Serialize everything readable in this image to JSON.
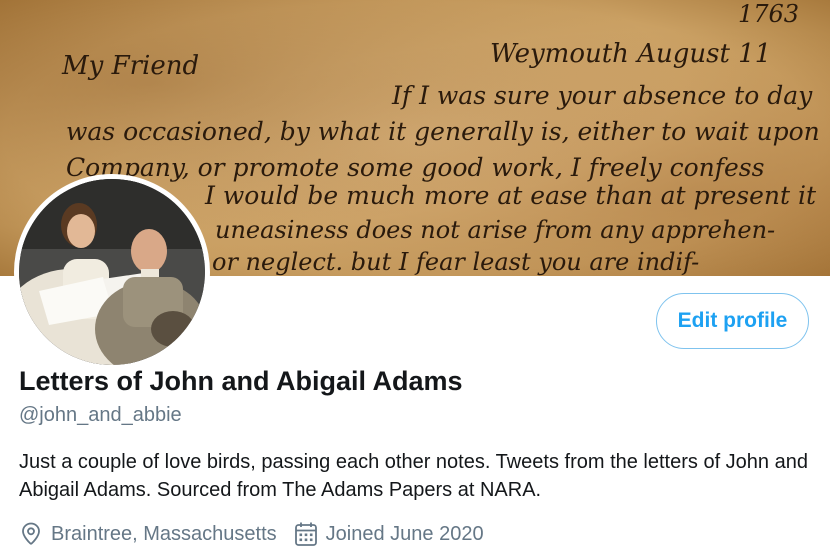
{
  "profile": {
    "name": "Letters of John and Abigail Adams",
    "handle": "@john_and_abbie",
    "bio": "Just a couple of love birds, passing each other notes. Tweets from the letters of John and Abigail Adams. Sourced from The Adams Papers at NARA.",
    "location": "Braintree, Massachusetts",
    "joined": "Joined June 2020",
    "location_icon": "location-pin-icon",
    "calendar_icon": "calendar-icon"
  },
  "actions": {
    "edit_profile_label": "Edit profile"
  },
  "banner": {
    "handwriting": {
      "year": "1763",
      "salutation": "My Friend",
      "place_date": "Weymouth August 11",
      "lines": [
        "If I was sure your absence to day",
        "was occasioned, by what it generally is, either to wait upon",
        "Company, or promote some good work, I freely confess",
        "I would be much more at ease than at present it",
        "uneasiness does not arise from any apprehen-",
        "or neglect. but I fear least you are indif-"
      ]
    }
  },
  "colors": {
    "accent": "#1da1f2",
    "secondary_text": "#657786",
    "primary_text": "#14171a"
  }
}
